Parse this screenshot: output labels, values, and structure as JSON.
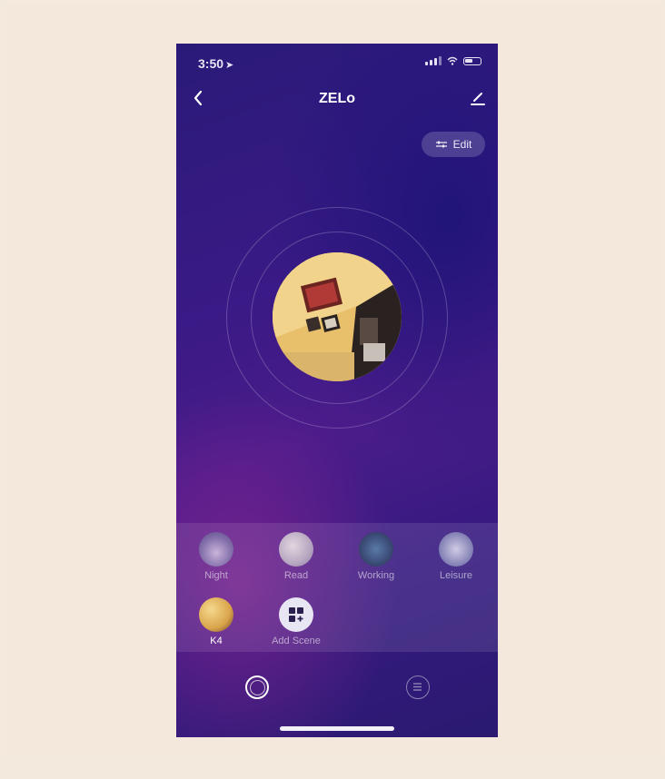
{
  "status": {
    "time": "3:50"
  },
  "header": {
    "title": "ZELo"
  },
  "toolbar": {
    "edit_label": "Edit"
  },
  "scenes": [
    {
      "label": "Night"
    },
    {
      "label": "Read"
    },
    {
      "label": "Working"
    },
    {
      "label": "Leisure"
    },
    {
      "label": "K4",
      "selected": true
    },
    {
      "label": "Add Scene"
    }
  ],
  "icons": {
    "back": "chevron-left-icon",
    "edit_pencil": "pencil-icon",
    "edit_sliders": "sliders-icon",
    "add_scene": "grid-plus-icon",
    "tab_light": "ring-icon",
    "tab_menu": "menu-circle-icon"
  },
  "colors": {
    "accent": "#3a1a86",
    "background": "#f4e9dd"
  }
}
